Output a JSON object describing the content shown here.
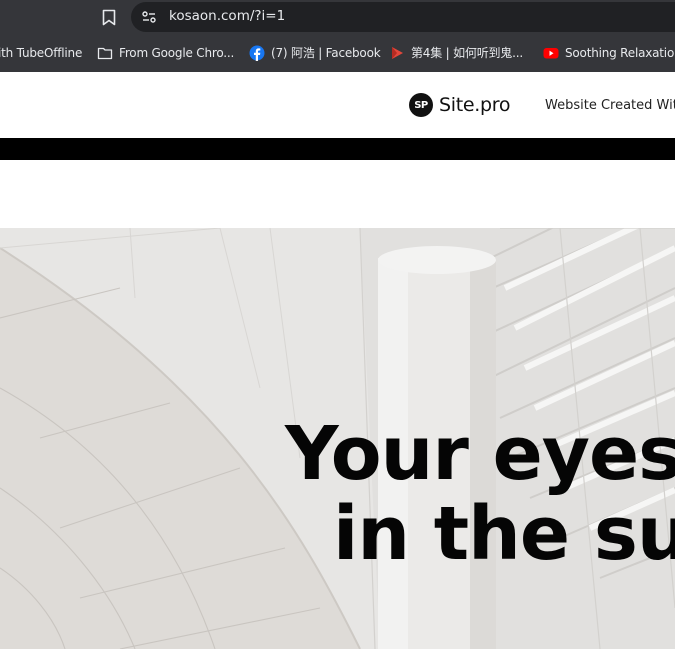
{
  "browser": {
    "url": "kosaon.com/?i=1",
    "bookmarks": [
      {
        "label": "ith TubeOffline",
        "icon": "none"
      },
      {
        "label": "From Google Chro...",
        "icon": "folder-icon"
      },
      {
        "label": "(7) 阿浩 | Facebook",
        "icon": "facebook-icon"
      },
      {
        "label": "第4集 | 如何听到鬼...",
        "icon": "video-play-icon"
      },
      {
        "label": "Soothing Relaxation...",
        "icon": "youtube-icon"
      }
    ]
  },
  "site": {
    "logo_badge": "SP",
    "logo_text": "Site.pro",
    "created_text": "Website Created Wit"
  },
  "hero": {
    "headline_line1": "Your eyes",
    "headline_line2": "in the sur"
  },
  "colors": {
    "chrome_bg": "#35363a",
    "address_bg": "#202124",
    "facebook_blue": "#1877f2",
    "youtube_red": "#ff0000",
    "hero_bg": "#e9e8e6"
  }
}
